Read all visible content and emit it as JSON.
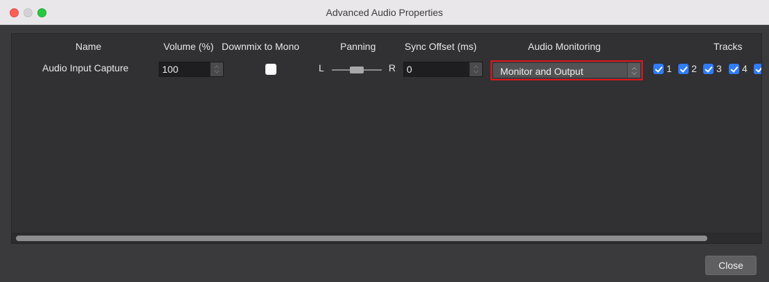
{
  "window": {
    "title": "Advanced Audio Properties"
  },
  "headers": {
    "name": "Name",
    "volume": "Volume (%)",
    "downmix": "Downmix to Mono",
    "panning": "Panning",
    "sync_offset": "Sync Offset (ms)",
    "monitoring": "Audio Monitoring",
    "tracks": "Tracks"
  },
  "row": {
    "name": "Audio Input Capture",
    "volume": "100",
    "downmix_checked": false,
    "pan_left": "L",
    "pan_right": "R",
    "pan_level": 0.5,
    "sync_offset": "0",
    "monitoring": "Monitor and Output",
    "tracks": [
      {
        "label": "1",
        "checked": true
      },
      {
        "label": "2",
        "checked": true
      },
      {
        "label": "3",
        "checked": true
      },
      {
        "label": "4",
        "checked": true
      },
      {
        "label": "",
        "checked": true
      }
    ]
  },
  "buttons": {
    "close": "Close"
  },
  "colors": {
    "highlight": "#e2151c",
    "checkbox_accent": "#2f7cf6"
  }
}
